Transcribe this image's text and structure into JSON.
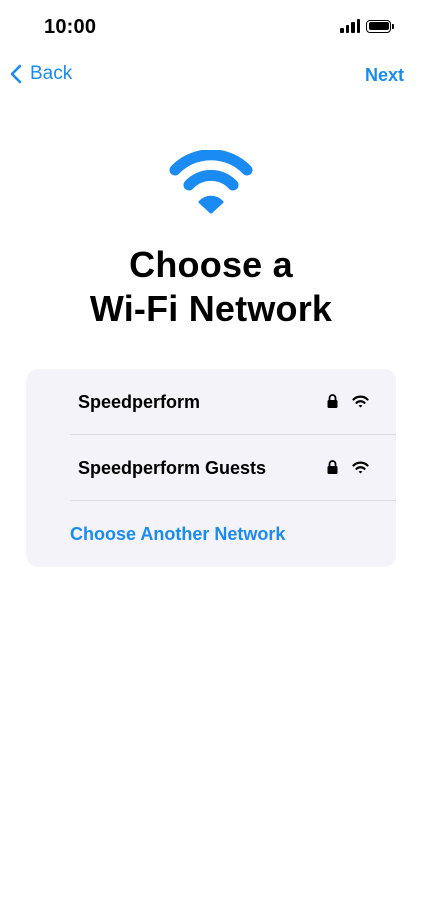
{
  "status_bar": {
    "time": "10:00",
    "signal_icon": "cellular-signal-icon",
    "battery_icon": "battery-icon"
  },
  "nav": {
    "back_label": "Back",
    "back_icon": "chevron-left-icon",
    "next_label": "Next"
  },
  "hero": {
    "icon": "wifi-icon",
    "title_line1": "Choose a",
    "title_line2": "Wi-Fi Network"
  },
  "networks": [
    {
      "name": "Speedperform",
      "secured": true,
      "lock_icon": "lock-icon",
      "signal_icon": "wifi-signal-icon"
    },
    {
      "name": "Speedperform Guests",
      "secured": true,
      "lock_icon": "lock-icon",
      "signal_icon": "wifi-signal-icon"
    }
  ],
  "other_network_label": "Choose Another Network",
  "colors": {
    "accent": "#1a8bf2",
    "card_background": "#f3f3f9",
    "divider": "#dcdce2"
  }
}
